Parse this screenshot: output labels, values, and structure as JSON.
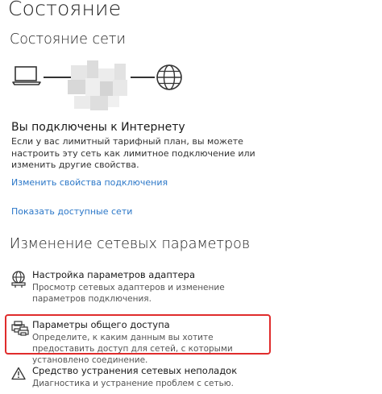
{
  "page": {
    "title": "Состояние"
  },
  "network_status": {
    "section_title": "Состояние сети",
    "connected_heading": "Вы подключены к Интернету",
    "connected_text": "Если у вас лимитный тарифный план, вы можете настроить эту сеть как лимитное подключение или изменить другие свойства.",
    "links": {
      "change_properties": "Изменить свойства подключения",
      "show_networks": "Показать доступные сети"
    },
    "icons": {
      "device": "laptop-icon",
      "internet": "globe-icon"
    }
  },
  "change_settings": {
    "section_title": "Изменение сетевых параметров",
    "items": [
      {
        "icon": "adapter-icon",
        "title": "Настройка параметров адаптера",
        "description": "Просмотр сетевых адаптеров и изменение параметров подключения."
      },
      {
        "icon": "sharing-icon",
        "title": "Параметры общего доступа",
        "description": "Определите, к каким данным вы хотите предоставить доступ для сетей, с которыми установлено соединение.",
        "highlighted": true
      },
      {
        "icon": "warning-icon",
        "title": "Средство устранения сетевых неполадок",
        "description": "Диагностика и устранение проблем с сетью."
      }
    ]
  },
  "colors": {
    "link": "#2b77c8",
    "highlight": "#e02c2c",
    "background": "#ffffff"
  }
}
